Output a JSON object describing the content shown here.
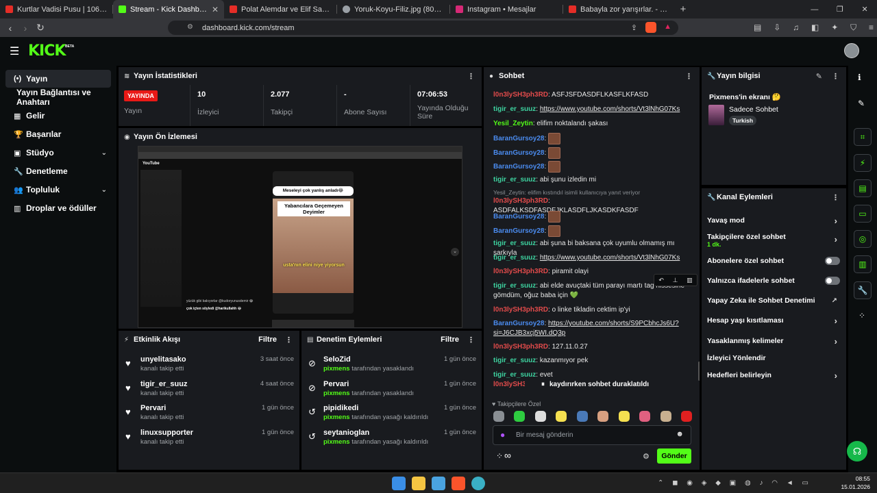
{
  "browser": {
    "tabs": [
      {
        "title": "Kurtlar Vadisi Pusu | 106. Bölüm | Yük",
        "color": "#e52d27"
      },
      {
        "title": "Stream - Kick Dashboard",
        "color": "#53fc18",
        "active": true
      },
      {
        "title": "Polat Alemdar ve Elif Sahneleri (Part",
        "color": "#e52d27"
      },
      {
        "title": "Yoruk-Koyu-Filiz.jpg (800×600)",
        "color": "#9aa0a6"
      },
      {
        "title": "Instagram • Mesajlar",
        "color": "#d62976"
      },
      {
        "title": "Babayla zor yarışırlar. - YouTube",
        "color": "#e52d27"
      }
    ],
    "url": "dashboard.kick.com/stream",
    "new_tab": "+",
    "close_glyph": "✕"
  },
  "header": {
    "logo": "KICK",
    "beta": "BETA"
  },
  "sidebar": {
    "items": [
      {
        "label": "Yayın",
        "icon": "broadcast-icon",
        "glyph": "(•)",
        "active": true
      },
      {
        "label": "Yayın Bağlantısı ve Anahtarı",
        "icon": "",
        "glyph": ""
      },
      {
        "label": "Gelir",
        "icon": "revenue-icon",
        "glyph": "▦"
      },
      {
        "label": "Başarılar",
        "icon": "trophy-icon",
        "glyph": "🏆"
      },
      {
        "label": "Stüdyo",
        "icon": "studio-icon",
        "glyph": "▣",
        "expand": true
      },
      {
        "label": "Denetleme",
        "icon": "wrench-icon",
        "glyph": "🔧"
      },
      {
        "label": "Topluluk",
        "icon": "community-icon",
        "glyph": "👥",
        "expand": true
      },
      {
        "label": "Droplar ve ödüller",
        "icon": "drops-icon",
        "glyph": "▥"
      }
    ]
  },
  "stats": {
    "title": "Yayın İstatistikleri",
    "live_label": "YAYINDA",
    "live_sub": "Yayın",
    "items": [
      {
        "value": "10",
        "label": "İzleyici"
      },
      {
        "value": "2.077",
        "label": "Takipçi"
      },
      {
        "value": "-",
        "label": "Abone Sayısı"
      },
      {
        "value": "07:06:53",
        "label": "Yayında Olduğu Süre"
      }
    ]
  },
  "preview": {
    "title": "Yayın Ön İzlemesi",
    "card_top": "Meseleyi çok yanlış anladı😂",
    "card_mid": "Yabancılara Geçemeyen Deyimler",
    "card_bottom": "usta'nın elini niye yiyorsun",
    "yt_logo": "YouTube",
    "comment1": "yüzük gibi bakıyorlar @kudoryunusdemir 😂",
    "comment2": "çok içten söyledi @harikullahh 😂"
  },
  "activity": {
    "title": "Etkinlik Akışı",
    "filter": "Filtre",
    "items": [
      {
        "name": "unyelitasako",
        "sub": "kanalı takip etti",
        "time": "3 saat önce"
      },
      {
        "name": "tigir_er_suuz",
        "sub": "kanalı takip etti",
        "time": "4 saat önce"
      },
      {
        "name": "Pervari",
        "sub": "kanalı takip etti",
        "time": "1 gün önce"
      },
      {
        "name": "linuxsupporter",
        "sub": "kanalı takip etti",
        "time": "1 gün önce"
      }
    ]
  },
  "modactions": {
    "title": "Denetim Eylemleri",
    "filter": "Filtre",
    "items": [
      {
        "name": "SeloZid",
        "by": "pixmens",
        "action": "tarafından yasaklandı",
        "time": "1 gün önce",
        "icon": "ban-icon",
        "glyph": "⊘"
      },
      {
        "name": "Pervari",
        "by": "pixmens",
        "action": "tarafından yasaklandı",
        "time": "1 gün önce",
        "icon": "ban-icon",
        "glyph": "⊘"
      },
      {
        "name": "pipidikedi",
        "by": "pixmens",
        "action": "tarafından yasağı kaldırıldı",
        "time": "1 gün önce",
        "icon": "unban-icon",
        "glyph": "↺"
      },
      {
        "name": "seytanioglan",
        "by": "pixmens",
        "action": "tarafından yasağı kaldırıldı",
        "time": "1 gün önce",
        "icon": "unban-icon",
        "glyph": "↺"
      }
    ]
  },
  "chat": {
    "title": "Sohbet",
    "reply_note": "Yesil_Zeytin: elifim kıstındıl isimli kullanıcıya yanıt veriyor",
    "lines": [
      {
        "user": "l0n3lySH3ph3RD",
        "color": "#e24b4b",
        "text": "ASFJSFDASDFLKASFLKFASD"
      },
      {
        "user": "tigir_er_suuz",
        "color": "#3ed3a0",
        "text": "https://www.youtube.com/shorts/Vt3lNhG07Ks",
        "link": true
      },
      {
        "user": "Yesil_Zeytin",
        "color": "#53fc18",
        "text": "elifim noktalandı şakası"
      },
      {
        "user": "BaranGursoy28",
        "color": "#4b8cf0",
        "emote": true
      },
      {
        "user": "BaranGursoy28",
        "color": "#4b8cf0",
        "emote": true
      },
      {
        "user": "BaranGursoy28",
        "color": "#4b8cf0",
        "emote": true
      },
      {
        "user": "tigir_er_suuz",
        "color": "#3ed3a0",
        "text": "abi şunu izledin mi"
      },
      {
        "user": "l0n3lySH3ph3RD",
        "color": "#e24b4b",
        "text": "ASDFALKSDFASDFJKLASDFLJKASDKFASDF"
      },
      {
        "user": "BaranGursoy28",
        "color": "#4b8cf0",
        "emote": true
      },
      {
        "user": "BaranGursoy28",
        "color": "#4b8cf0",
        "emote": true
      },
      {
        "user": "tigir_er_suuz",
        "color": "#3ed3a0",
        "text": "abi şuna bi baksana çok uyumlu olmamış mı şarkıyla"
      },
      {
        "user": "tigir_er_suuz",
        "color": "#3ed3a0",
        "text": "https://www.youtube.com/shorts/Vt3lNhG07Ks",
        "link": true
      },
      {
        "user": "l0n3lySH3ph3RD",
        "color": "#e24b4b",
        "text": "piramit olayi"
      },
      {
        "user": "tigir_er_suuz",
        "color": "#3ed3a0",
        "text": "abi elde avuçtaki tüm parayı martı tag hissesine gömdüm, oğuz baba için 💚"
      },
      {
        "user": "l0n3lySH3ph3RD",
        "color": "#e24b4b",
        "text": "o linke tikladin cektim ip'yi"
      },
      {
        "user": "BaranGursoy28",
        "color": "#4b8cf0",
        "text": "https://youtube.com/shorts/S9PCbhcJs6U?si=J6CJB3xcj5WI.dQ3p",
        "link": true
      },
      {
        "user": "l0n3lySH3ph3RD",
        "color": "#e24b4b",
        "text": "127.11.0.27"
      },
      {
        "user": "tigir_er_suuz",
        "color": "#3ed3a0",
        "text": "kazanmıyor pek"
      },
      {
        "user": "tigir_er_suuz",
        "color": "#3ed3a0",
        "text": "evet"
      },
      {
        "user": "l0n3lySH3ph3",
        "color": "#e24b4b",
        "text": ""
      }
    ],
    "paused": "kaydırırken sohbet duraklatıldı",
    "followers_only": "Takipçilere Özel",
    "input_placeholder": "Bir mesaj gönderin",
    "send": "Gönder",
    "infinity": "∞"
  },
  "streaminfo": {
    "title": "Yayın bilgisi",
    "headline": "Pixmens'in ekranı 🤔",
    "category": "Sadece Sohbet",
    "tag": "Turkish"
  },
  "channel_actions": {
    "title": "Kanal Eylemleri",
    "items": [
      {
        "label": "Yavaş mod",
        "kind": "arrow"
      },
      {
        "label": "Takipçilere özel sohbet",
        "sub": "1 dk.",
        "kind": "arrow"
      },
      {
        "label": "Abonelere özel sohbet",
        "kind": "toggle"
      },
      {
        "label": "Yalnızca ifadelerle sohbet",
        "kind": "toggle"
      },
      {
        "label": "Yapay Zeka ile Sohbet Denetimi",
        "kind": "external"
      },
      {
        "label": "Hesap yaşı kısıtlaması",
        "kind": "arrow"
      },
      {
        "label": "Yasaklanmış kelimeler",
        "kind": "arrow"
      },
      {
        "label": "İzleyici Yönlendir",
        "kind": "none"
      },
      {
        "label": "Hedefleri belirleyin",
        "kind": "arrow"
      }
    ]
  },
  "taskbar": {
    "time": "08:55",
    "date": "15.01.2026"
  },
  "colors": {
    "kick_green": "#53fc18",
    "panel": "#191b1f",
    "live_red": "#e91916"
  }
}
